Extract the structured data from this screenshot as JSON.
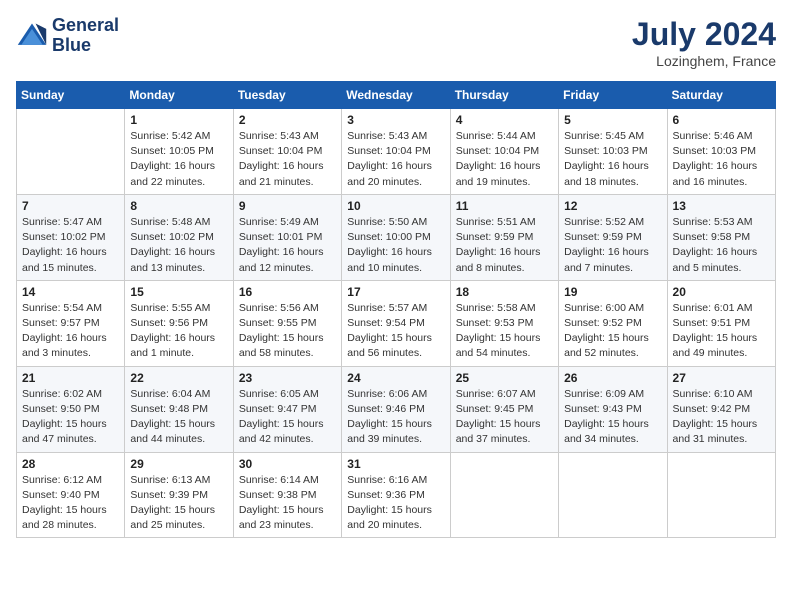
{
  "header": {
    "logo_line1": "General",
    "logo_line2": "Blue",
    "month_title": "July 2024",
    "location": "Lozinghem, France"
  },
  "calendar": {
    "columns": [
      "Sunday",
      "Monday",
      "Tuesday",
      "Wednesday",
      "Thursday",
      "Friday",
      "Saturday"
    ],
    "weeks": [
      [
        {
          "day": "",
          "sunrise": "",
          "sunset": "",
          "daylight": ""
        },
        {
          "day": "1",
          "sunrise": "Sunrise: 5:42 AM",
          "sunset": "Sunset: 10:05 PM",
          "daylight": "Daylight: 16 hours and 22 minutes."
        },
        {
          "day": "2",
          "sunrise": "Sunrise: 5:43 AM",
          "sunset": "Sunset: 10:04 PM",
          "daylight": "Daylight: 16 hours and 21 minutes."
        },
        {
          "day": "3",
          "sunrise": "Sunrise: 5:43 AM",
          "sunset": "Sunset: 10:04 PM",
          "daylight": "Daylight: 16 hours and 20 minutes."
        },
        {
          "day": "4",
          "sunrise": "Sunrise: 5:44 AM",
          "sunset": "Sunset: 10:04 PM",
          "daylight": "Daylight: 16 hours and 19 minutes."
        },
        {
          "day": "5",
          "sunrise": "Sunrise: 5:45 AM",
          "sunset": "Sunset: 10:03 PM",
          "daylight": "Daylight: 16 hours and 18 minutes."
        },
        {
          "day": "6",
          "sunrise": "Sunrise: 5:46 AM",
          "sunset": "Sunset: 10:03 PM",
          "daylight": "Daylight: 16 hours and 16 minutes."
        }
      ],
      [
        {
          "day": "7",
          "sunrise": "Sunrise: 5:47 AM",
          "sunset": "Sunset: 10:02 PM",
          "daylight": "Daylight: 16 hours and 15 minutes."
        },
        {
          "day": "8",
          "sunrise": "Sunrise: 5:48 AM",
          "sunset": "Sunset: 10:02 PM",
          "daylight": "Daylight: 16 hours and 13 minutes."
        },
        {
          "day": "9",
          "sunrise": "Sunrise: 5:49 AM",
          "sunset": "Sunset: 10:01 PM",
          "daylight": "Daylight: 16 hours and 12 minutes."
        },
        {
          "day": "10",
          "sunrise": "Sunrise: 5:50 AM",
          "sunset": "Sunset: 10:00 PM",
          "daylight": "Daylight: 16 hours and 10 minutes."
        },
        {
          "day": "11",
          "sunrise": "Sunrise: 5:51 AM",
          "sunset": "Sunset: 9:59 PM",
          "daylight": "Daylight: 16 hours and 8 minutes."
        },
        {
          "day": "12",
          "sunrise": "Sunrise: 5:52 AM",
          "sunset": "Sunset: 9:59 PM",
          "daylight": "Daylight: 16 hours and 7 minutes."
        },
        {
          "day": "13",
          "sunrise": "Sunrise: 5:53 AM",
          "sunset": "Sunset: 9:58 PM",
          "daylight": "Daylight: 16 hours and 5 minutes."
        }
      ],
      [
        {
          "day": "14",
          "sunrise": "Sunrise: 5:54 AM",
          "sunset": "Sunset: 9:57 PM",
          "daylight": "Daylight: 16 hours and 3 minutes."
        },
        {
          "day": "15",
          "sunrise": "Sunrise: 5:55 AM",
          "sunset": "Sunset: 9:56 PM",
          "daylight": "Daylight: 16 hours and 1 minute."
        },
        {
          "day": "16",
          "sunrise": "Sunrise: 5:56 AM",
          "sunset": "Sunset: 9:55 PM",
          "daylight": "Daylight: 15 hours and 58 minutes."
        },
        {
          "day": "17",
          "sunrise": "Sunrise: 5:57 AM",
          "sunset": "Sunset: 9:54 PM",
          "daylight": "Daylight: 15 hours and 56 minutes."
        },
        {
          "day": "18",
          "sunrise": "Sunrise: 5:58 AM",
          "sunset": "Sunset: 9:53 PM",
          "daylight": "Daylight: 15 hours and 54 minutes."
        },
        {
          "day": "19",
          "sunrise": "Sunrise: 6:00 AM",
          "sunset": "Sunset: 9:52 PM",
          "daylight": "Daylight: 15 hours and 52 minutes."
        },
        {
          "day": "20",
          "sunrise": "Sunrise: 6:01 AM",
          "sunset": "Sunset: 9:51 PM",
          "daylight": "Daylight: 15 hours and 49 minutes."
        }
      ],
      [
        {
          "day": "21",
          "sunrise": "Sunrise: 6:02 AM",
          "sunset": "Sunset: 9:50 PM",
          "daylight": "Daylight: 15 hours and 47 minutes."
        },
        {
          "day": "22",
          "sunrise": "Sunrise: 6:04 AM",
          "sunset": "Sunset: 9:48 PM",
          "daylight": "Daylight: 15 hours and 44 minutes."
        },
        {
          "day": "23",
          "sunrise": "Sunrise: 6:05 AM",
          "sunset": "Sunset: 9:47 PM",
          "daylight": "Daylight: 15 hours and 42 minutes."
        },
        {
          "day": "24",
          "sunrise": "Sunrise: 6:06 AM",
          "sunset": "Sunset: 9:46 PM",
          "daylight": "Daylight: 15 hours and 39 minutes."
        },
        {
          "day": "25",
          "sunrise": "Sunrise: 6:07 AM",
          "sunset": "Sunset: 9:45 PM",
          "daylight": "Daylight: 15 hours and 37 minutes."
        },
        {
          "day": "26",
          "sunrise": "Sunrise: 6:09 AM",
          "sunset": "Sunset: 9:43 PM",
          "daylight": "Daylight: 15 hours and 34 minutes."
        },
        {
          "day": "27",
          "sunrise": "Sunrise: 6:10 AM",
          "sunset": "Sunset: 9:42 PM",
          "daylight": "Daylight: 15 hours and 31 minutes."
        }
      ],
      [
        {
          "day": "28",
          "sunrise": "Sunrise: 6:12 AM",
          "sunset": "Sunset: 9:40 PM",
          "daylight": "Daylight: 15 hours and 28 minutes."
        },
        {
          "day": "29",
          "sunrise": "Sunrise: 6:13 AM",
          "sunset": "Sunset: 9:39 PM",
          "daylight": "Daylight: 15 hours and 25 minutes."
        },
        {
          "day": "30",
          "sunrise": "Sunrise: 6:14 AM",
          "sunset": "Sunset: 9:38 PM",
          "daylight": "Daylight: 15 hours and 23 minutes."
        },
        {
          "day": "31",
          "sunrise": "Sunrise: 6:16 AM",
          "sunset": "Sunset: 9:36 PM",
          "daylight": "Daylight: 15 hours and 20 minutes."
        },
        {
          "day": "",
          "sunrise": "",
          "sunset": "",
          "daylight": ""
        },
        {
          "day": "",
          "sunrise": "",
          "sunset": "",
          "daylight": ""
        },
        {
          "day": "",
          "sunrise": "",
          "sunset": "",
          "daylight": ""
        }
      ]
    ]
  }
}
